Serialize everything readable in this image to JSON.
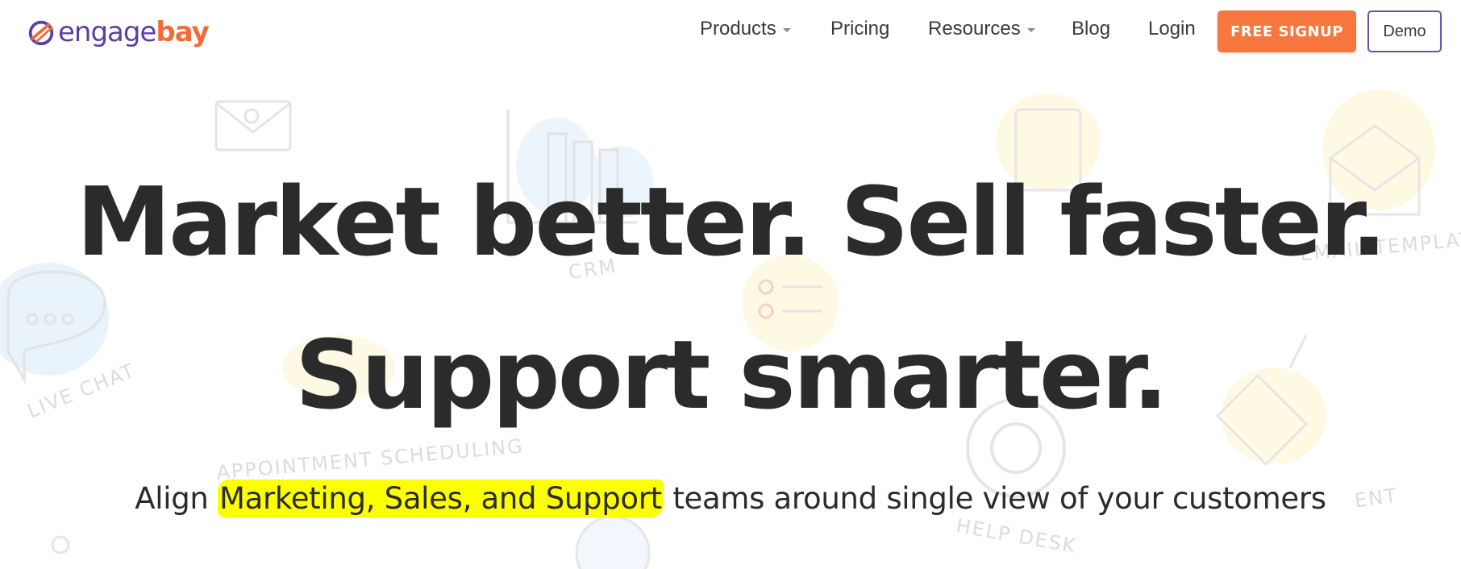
{
  "brand": {
    "logo_part1": "engage",
    "logo_part2": "bay",
    "logo_icon": "engagebay-logo-icon",
    "colors": {
      "purple": "#5b3ea8",
      "orange": "#f26b3a"
    }
  },
  "nav": {
    "items": [
      {
        "label": "Products",
        "dropdown": true
      },
      {
        "label": "Pricing",
        "dropdown": false
      },
      {
        "label": "Resources",
        "dropdown": true
      },
      {
        "label": "Blog",
        "dropdown": false
      },
      {
        "label": "Login",
        "dropdown": false
      }
    ],
    "signup_label": "FREE SIGNUP",
    "demo_label": "Demo",
    "colors": {
      "signup_bg": "#f7773e",
      "demo_border": "#6a53a8"
    }
  },
  "background_labels": [
    "LIVE CHAT",
    "CRM",
    "APPOINTMENT SCHEDULING",
    "HELP DESK",
    "EMAIL TEMPLAT",
    "ENT"
  ],
  "hero": {
    "headline_line1": "Market better. Sell faster.",
    "headline_line2": "Support smarter.",
    "sub_before": "Align ",
    "sub_highlight": "Marketing, Sales, and Support",
    "sub_after": " teams around single view of your customers",
    "highlight_color": "#fbff00"
  }
}
